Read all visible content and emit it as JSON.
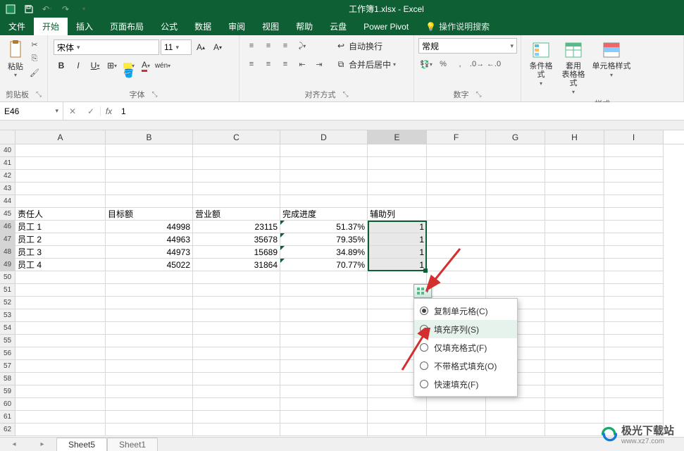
{
  "title": "工作簿1.xlsx - Excel",
  "quick_access": {
    "save_icon": "save",
    "undo_icon": "undo",
    "redo_icon": "redo"
  },
  "menu": {
    "file": "文件",
    "home": "开始",
    "insert": "插入",
    "page_layout": "页面布局",
    "formulas": "公式",
    "data": "数据",
    "review": "审阅",
    "view": "视图",
    "help": "帮助",
    "cloud": "云盘",
    "power_pivot": "Power Pivot",
    "tell_me": "操作说明搜索"
  },
  "ribbon": {
    "clipboard": {
      "paste": "粘贴",
      "label": "剪贴板"
    },
    "font": {
      "family": "宋体",
      "size": "11",
      "b": "B",
      "i": "I",
      "u": "U",
      "label": "字体"
    },
    "alignment": {
      "wrap": "自动换行",
      "merge": "合并后居中",
      "label": "对齐方式"
    },
    "number": {
      "format": "常规",
      "label": "数字"
    },
    "styles": {
      "cond_fmt": "条件格式",
      "table_fmt": "套用\n表格格式",
      "cell_styles": "单元格样式",
      "label": "样式"
    }
  },
  "name_box": "E46",
  "formula_bar": "1",
  "columns": [
    "A",
    "B",
    "C",
    "D",
    "E",
    "F",
    "G",
    "H",
    "I"
  ],
  "row_start": 40,
  "rows": [
    {
      "n": 40,
      "A": "",
      "B": "",
      "C": "",
      "D": "",
      "E": "",
      "F": "",
      "G": "",
      "H": "",
      "I": ""
    },
    {
      "n": 41,
      "A": "",
      "B": "",
      "C": "",
      "D": "",
      "E": "",
      "F": "",
      "G": "",
      "H": "",
      "I": ""
    },
    {
      "n": 42,
      "A": "",
      "B": "",
      "C": "",
      "D": "",
      "E": "",
      "F": "",
      "G": "",
      "H": "",
      "I": ""
    },
    {
      "n": 43,
      "A": "",
      "B": "",
      "C": "",
      "D": "",
      "E": "",
      "F": "",
      "G": "",
      "H": "",
      "I": ""
    },
    {
      "n": 44,
      "A": "",
      "B": "",
      "C": "",
      "D": "",
      "E": "",
      "F": "",
      "G": "",
      "H": "",
      "I": ""
    },
    {
      "n": 45,
      "A": "责任人",
      "B": "目标额",
      "C": "营业额",
      "D": "完成进度",
      "E": "辅助列",
      "F": "",
      "G": "",
      "H": "",
      "I": ""
    },
    {
      "n": 46,
      "A": "员工 1",
      "B": "44998",
      "C": "23115",
      "D": "51.37%",
      "E": "1",
      "F": "",
      "G": "",
      "H": "",
      "I": ""
    },
    {
      "n": 47,
      "A": "员工 2",
      "B": "44963",
      "C": "35678",
      "D": "79.35%",
      "E": "1",
      "F": "",
      "G": "",
      "H": "",
      "I": ""
    },
    {
      "n": 48,
      "A": "员工 3",
      "B": "44973",
      "C": "15689",
      "D": "34.89%",
      "E": "1",
      "F": "",
      "G": "",
      "H": "",
      "I": ""
    },
    {
      "n": 49,
      "A": "员工 4",
      "B": "45022",
      "C": "31864",
      "D": "70.77%",
      "E": "1",
      "F": "",
      "G": "",
      "H": "",
      "I": ""
    },
    {
      "n": 50,
      "A": "",
      "B": "",
      "C": "",
      "D": "",
      "E": "",
      "F": "",
      "G": "",
      "H": "",
      "I": ""
    },
    {
      "n": 51,
      "A": "",
      "B": "",
      "C": "",
      "D": "",
      "E": "",
      "F": "",
      "G": "",
      "H": "",
      "I": ""
    },
    {
      "n": 52,
      "A": "",
      "B": "",
      "C": "",
      "D": "",
      "E": "",
      "F": "",
      "G": "",
      "H": "",
      "I": ""
    },
    {
      "n": 53,
      "A": "",
      "B": "",
      "C": "",
      "D": "",
      "E": "",
      "F": "",
      "G": "",
      "H": "",
      "I": ""
    },
    {
      "n": 54,
      "A": "",
      "B": "",
      "C": "",
      "D": "",
      "E": "",
      "F": "",
      "G": "",
      "H": "",
      "I": ""
    },
    {
      "n": 55,
      "A": "",
      "B": "",
      "C": "",
      "D": "",
      "E": "",
      "F": "",
      "G": "",
      "H": "",
      "I": ""
    },
    {
      "n": 56,
      "A": "",
      "B": "",
      "C": "",
      "D": "",
      "E": "",
      "F": "",
      "G": "",
      "H": "",
      "I": ""
    },
    {
      "n": 57,
      "A": "",
      "B": "",
      "C": "",
      "D": "",
      "E": "",
      "F": "",
      "G": "",
      "H": "",
      "I": ""
    },
    {
      "n": 58,
      "A": "",
      "B": "",
      "C": "",
      "D": "",
      "E": "",
      "F": "",
      "G": "",
      "H": "",
      "I": ""
    },
    {
      "n": 59,
      "A": "",
      "B": "",
      "C": "",
      "D": "",
      "E": "",
      "F": "",
      "G": "",
      "H": "",
      "I": ""
    },
    {
      "n": 60,
      "A": "",
      "B": "",
      "C": "",
      "D": "",
      "E": "",
      "F": "",
      "G": "",
      "H": "",
      "I": ""
    },
    {
      "n": 61,
      "A": "",
      "B": "",
      "C": "",
      "D": "",
      "E": "",
      "F": "",
      "G": "",
      "H": "",
      "I": ""
    },
    {
      "n": 62,
      "A": "",
      "B": "",
      "C": "",
      "D": "",
      "E": "",
      "F": "",
      "G": "",
      "H": "",
      "I": ""
    }
  ],
  "autofill_menu": {
    "copy_cells": "复制单元格(C)",
    "fill_series": "填充序列(S)",
    "fill_format_only": "仅填充格式(F)",
    "fill_without_format": "不带格式填充(O)",
    "flash_fill": "快速填充(F)"
  },
  "sheets": {
    "active": "Sheet5",
    "other": "Sheet1"
  },
  "watermark": {
    "text": "极光下载站",
    "url": "www.xz7.com"
  }
}
